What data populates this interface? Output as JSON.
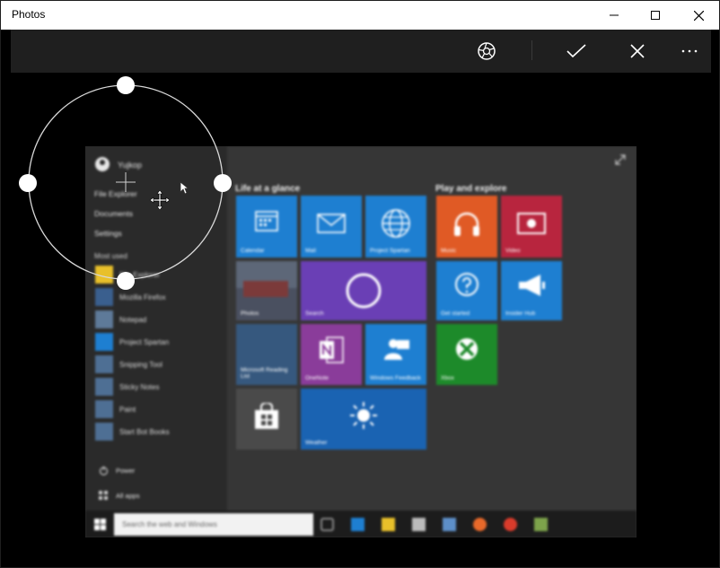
{
  "window": {
    "title": "Photos",
    "controls": {
      "minimize_icon": "minimize-icon",
      "maximize_icon": "maximize-icon",
      "close_icon": "close-icon"
    }
  },
  "toolbar": {
    "buttons": [
      {
        "name": "aperture-icon"
      },
      {
        "name": "check-icon"
      },
      {
        "name": "close-icon"
      },
      {
        "name": "more-icon",
        "label": "..."
      }
    ]
  },
  "photo": {
    "start_menu": {
      "user": "Yujkop",
      "items": [
        "File Explorer",
        "Documents",
        "Settings"
      ],
      "most_used_label": "Most used",
      "apps": [
        {
          "name": "File Explorer",
          "color": "#e8c02a"
        },
        {
          "name": "Mozilla Firefox",
          "color": "#e8692a"
        },
        {
          "name": "Notepad",
          "color": "#9fb6cf"
        },
        {
          "name": "Project Spartan",
          "color": "#1e7fd1"
        },
        {
          "name": "Snipping Tool",
          "color": "#6b8db3"
        },
        {
          "name": "Sticky Notes",
          "color": "#c8c83a"
        },
        {
          "name": "Paint",
          "color": "#7aa7d6"
        },
        {
          "name": "Start Bot Books",
          "color": "#c9a23a"
        }
      ],
      "power_label": "Power",
      "all_apps_label": "All apps"
    },
    "groups": [
      "Life at a glance",
      "Play and explore"
    ],
    "tiles": [
      {
        "label": "Calendar",
        "color": "#1e7fd1"
      },
      {
        "label": "Mail",
        "color": "#1e7fd1"
      },
      {
        "label": "Project Spartan",
        "color": "#1e7fd1"
      },
      {
        "label": "Photos",
        "color": "#4a5060"
      },
      {
        "label": "Search",
        "color": "#6a3fb5"
      },
      {
        "label": "Microsoft Reading List",
        "color": "#36587e"
      },
      {
        "label": "OneNote",
        "color": "#8a3c9a"
      },
      {
        "label": "Windows Feedback",
        "color": "#1e7fd1"
      },
      {
        "label": "",
        "color": "#4a4a4a"
      },
      {
        "label": "Weather",
        "color": "#1a63b2"
      },
      {
        "label": "Music",
        "color": "#e05a25"
      },
      {
        "label": "Video",
        "color": "#b8253e"
      },
      {
        "label": "Get started",
        "color": "#1e7fd1"
      },
      {
        "label": "Insider Hub",
        "color": "#1e7fd1"
      },
      {
        "label": "Xbox",
        "color": "#1d8a2a"
      }
    ],
    "taskbar": {
      "search_placeholder": "Search the web and Windows"
    }
  }
}
